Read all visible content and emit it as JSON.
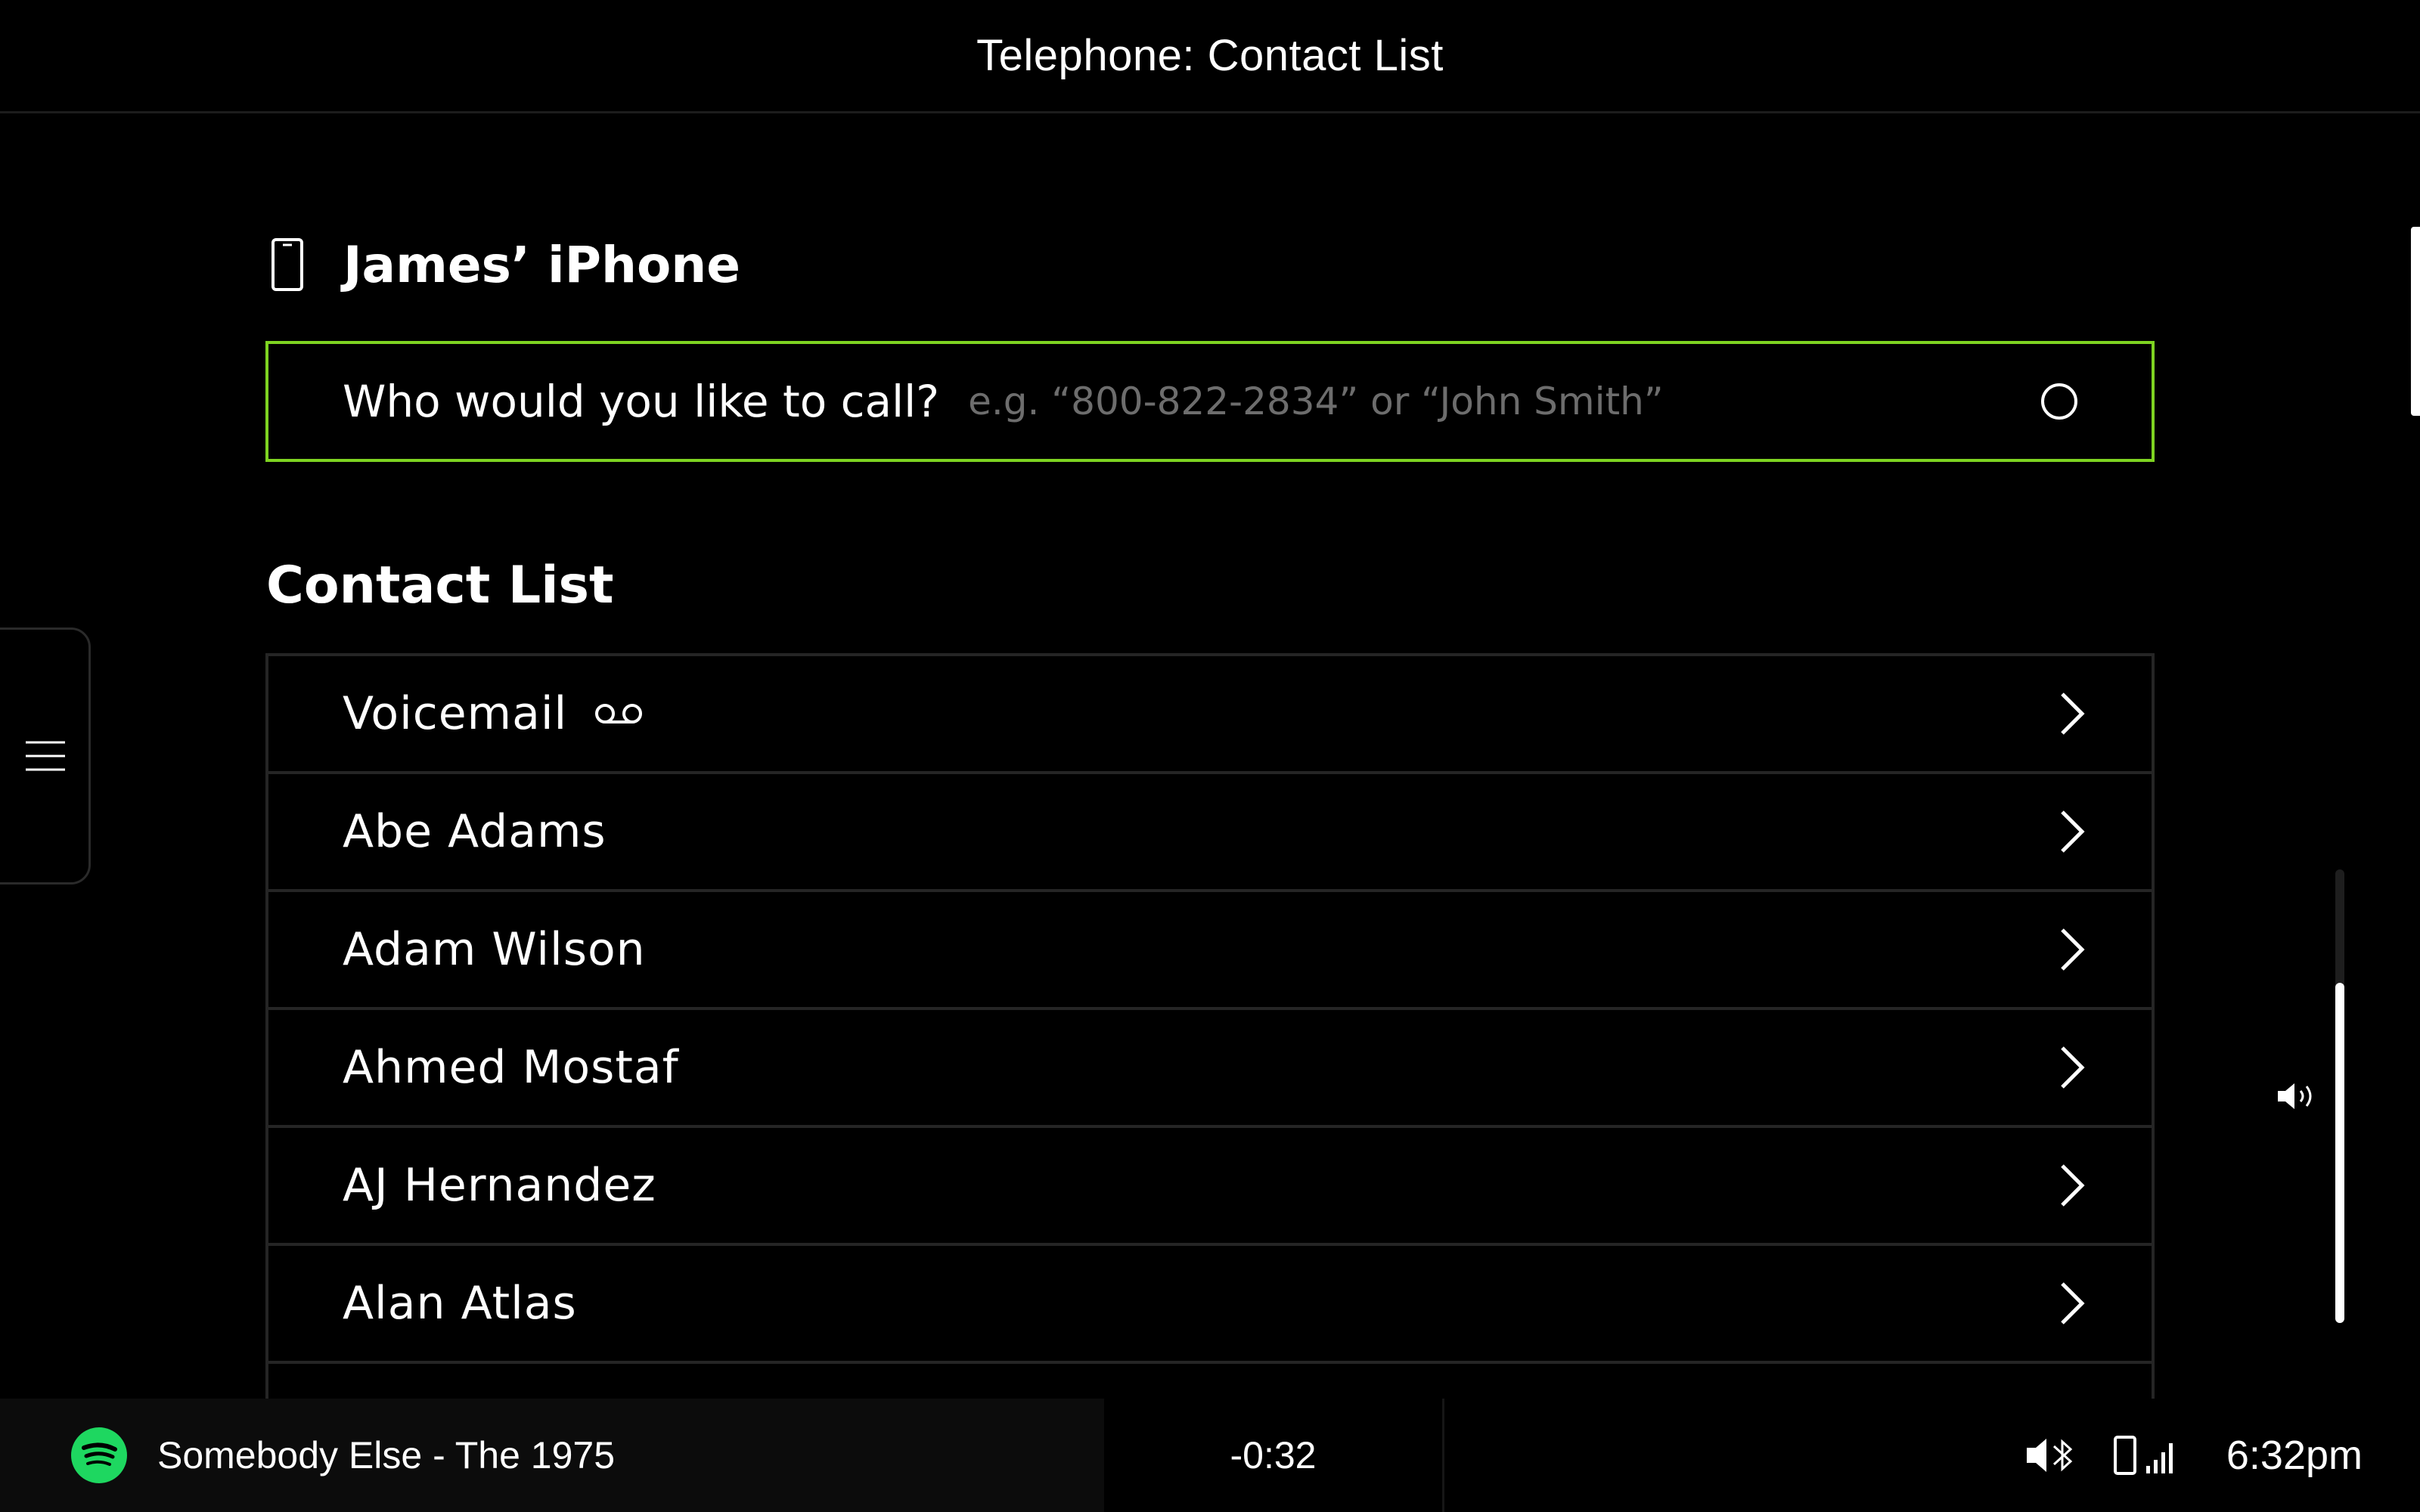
{
  "header": {
    "title": "Telephone: Contact List"
  },
  "device": {
    "name": "James’ iPhone",
    "icon": "phone-icon"
  },
  "search": {
    "prompt": "Who would you like to call?",
    "placeholder": "e.g. “800-822-2834” or “John Smith”",
    "value": "",
    "border_color": "#7ed321",
    "icon": "mic-icon"
  },
  "contacts": {
    "title": "Contact List",
    "items": [
      {
        "label": "Voicemail",
        "icon": "voicemail-icon"
      },
      {
        "label": "Abe Adams"
      },
      {
        "label": "Adam Wilson"
      },
      {
        "label": "Ahmed Mostaf"
      },
      {
        "label": "AJ Hernandez"
      },
      {
        "label": "Alan Atlas"
      },
      {
        "label": ""
      }
    ]
  },
  "volume": {
    "level": 0.75,
    "icon": "speaker-icon"
  },
  "player": {
    "app_icon": "spotify-icon",
    "brand_color": "#1ed760",
    "track": "Somebody Else - The 1975",
    "remaining": "-0:32"
  },
  "status": {
    "bluetooth_icon": "speaker-bluetooth-icon",
    "signal_icon": "phone-signal-icon",
    "time": "6:32pm"
  }
}
